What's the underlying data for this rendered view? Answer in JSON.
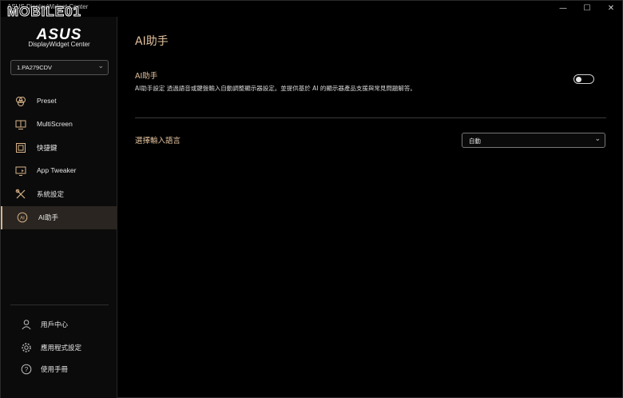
{
  "titlebar": {
    "app_title": "ASUS DisplayWidget Center",
    "watermark": "MOBILE01",
    "minimize_glyph": "—",
    "maximize_glyph": "☐",
    "close_glyph": "✕"
  },
  "sidebar": {
    "brand": "ASUS",
    "brand_sub": "DisplayWidget Center",
    "monitor_select": {
      "value": "1.PA279CDV"
    },
    "items": [
      {
        "label": "Preset",
        "icon": "preset-icon"
      },
      {
        "label": "MultiScreen",
        "icon": "multiscreen-icon"
      },
      {
        "label": "快捷鍵",
        "icon": "hotkey-icon"
      },
      {
        "label": "App Tweaker",
        "icon": "app-tweaker-icon"
      },
      {
        "label": "系統設定",
        "icon": "tools-icon"
      },
      {
        "label": "AI助手",
        "icon": "ai-icon",
        "active": true
      }
    ],
    "footer": [
      {
        "label": "用戶中心",
        "icon": "user-icon"
      },
      {
        "label": "應用程式設定",
        "icon": "gear-icon"
      },
      {
        "label": "使用手冊",
        "icon": "help-icon"
      }
    ]
  },
  "main": {
    "page_title": "AI助手",
    "ai_section": {
      "title": "AI助手",
      "description": "AI助手設定 透過語音或鍵盤輸入自動調整顯示器設定。並提供基於 AI 的顯示器產品支援與常見問題解答。",
      "toggle_on": false
    },
    "language": {
      "label": "選擇輸入語言",
      "value": "自動"
    }
  },
  "colors": {
    "accent": "#e3c29e",
    "active_bg": "#2a2520",
    "background": "#000000"
  }
}
